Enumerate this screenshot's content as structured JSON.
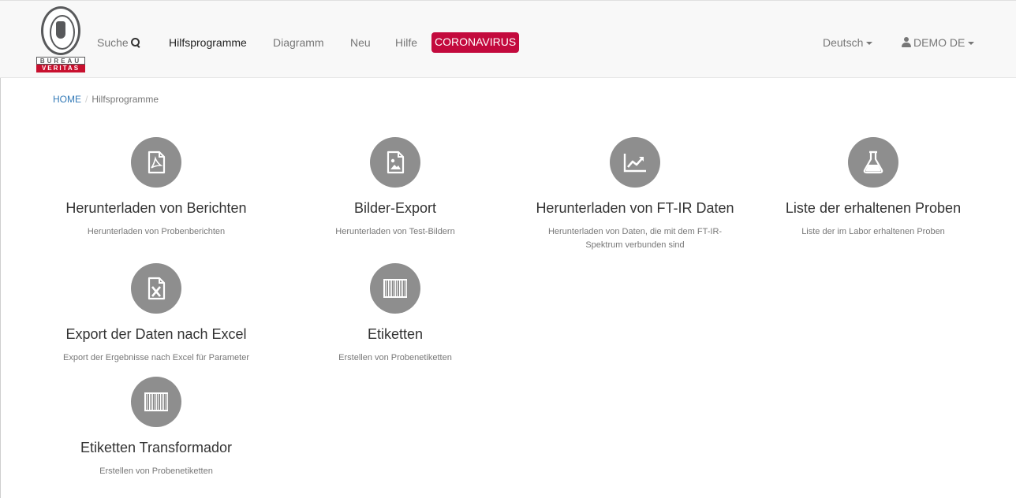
{
  "header": {
    "logo": {
      "bureau": "BUREAU",
      "veritas": "VERITAS"
    },
    "nav": [
      {
        "label": "Suche",
        "icon": "search-icon"
      },
      {
        "label": "Hilfsprogramme",
        "active": true
      },
      {
        "label": "Diagramm"
      },
      {
        "label": "Neu"
      },
      {
        "label": "Hilfe"
      },
      {
        "label": "CORONAVIRUS",
        "color": "#c30a3d"
      }
    ],
    "language": "Deutsch",
    "user": "DEMO DE"
  },
  "breadcrumb": {
    "home": "HOME",
    "separator": "/",
    "current": "Hilfsprogramme"
  },
  "tiles": [
    {
      "icon": "pdf-file-icon",
      "title": "Herunterladen von Berichten",
      "desc": "Herunterladen von Probenberichten"
    },
    {
      "icon": "image-file-icon",
      "title": "Bilder-Export",
      "desc": "Herunterladen von Test-Bildern"
    },
    {
      "icon": "line-chart-icon",
      "title": "Herunterladen von FT-IR Daten",
      "desc": "Herunterladen von Daten, die mit dem FT-IR-Spektrum verbunden sind"
    },
    {
      "icon": "flask-icon",
      "title": "Liste der erhaltenen Proben",
      "desc": "Liste der im Labor erhaltenen Proben"
    },
    {
      "icon": "excel-file-icon",
      "title": "Export der Daten nach Excel",
      "desc": "Export der Ergebnisse nach Excel für Parameter"
    },
    {
      "icon": "barcode-icon",
      "title": "Etiketten",
      "desc": "Erstellen von Probenetiketten"
    },
    {
      "icon": "barcode-icon",
      "title": "Etiketten Transformador",
      "desc": "Erstellen von Probenetiketten"
    }
  ],
  "colors": {
    "icon_circle": "#8e8e8e",
    "link": "#337ab7",
    "accent": "#c30a3d"
  }
}
